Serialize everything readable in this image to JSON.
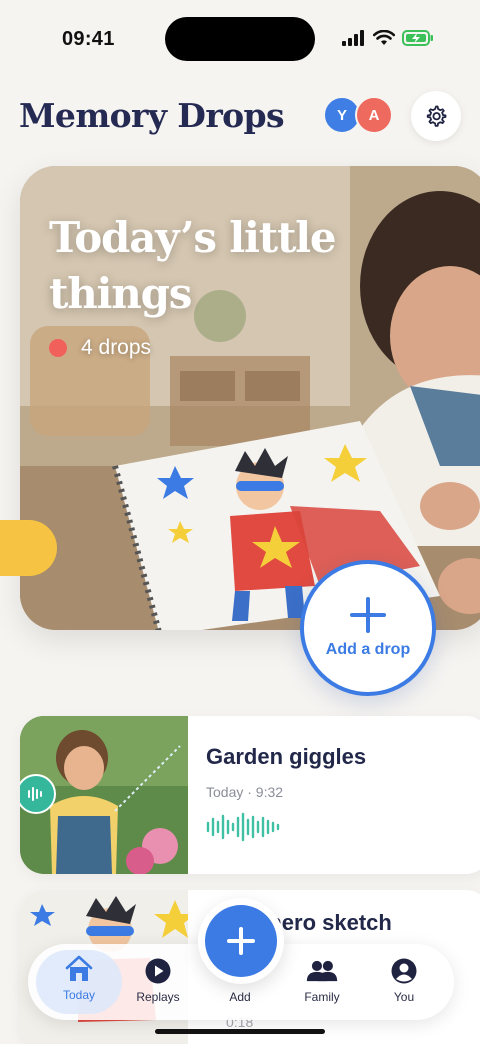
{
  "status_bar": {
    "time": "09:41"
  },
  "header": {
    "title": "Memory Drops",
    "avatars": [
      {
        "initial": "Y",
        "color": "#3f7ee4"
      },
      {
        "initial": "A",
        "color": "#ef6a5e"
      }
    ],
    "settings_icon": "gear-icon"
  },
  "hero": {
    "title": "Today’s little things",
    "count_label": "4 drops",
    "count_dot_color": "#f1605a",
    "add_button_label": "Add a drop"
  },
  "drops": [
    {
      "title": "Garden giggles",
      "meta": "Today · 9:32",
      "type": "audio",
      "icon": "waveform-icon"
    },
    {
      "title": "Superhero sketch",
      "meta_partial": "0:18"
    }
  ],
  "tab_bar": {
    "tabs": [
      {
        "label": "Today",
        "icon": "home-icon",
        "active": true
      },
      {
        "label": "Replays",
        "icon": "play-icon",
        "active": false
      },
      {
        "label": "Add",
        "icon": "plus-icon",
        "active": false
      },
      {
        "label": "Family",
        "icon": "people-icon",
        "active": false
      },
      {
        "label": "You",
        "icon": "person-icon",
        "active": false
      }
    ]
  },
  "colors": {
    "accent": "#3b7be3",
    "title": "#242a52",
    "audio": "#34b79a",
    "yellow": "#f6c442"
  }
}
